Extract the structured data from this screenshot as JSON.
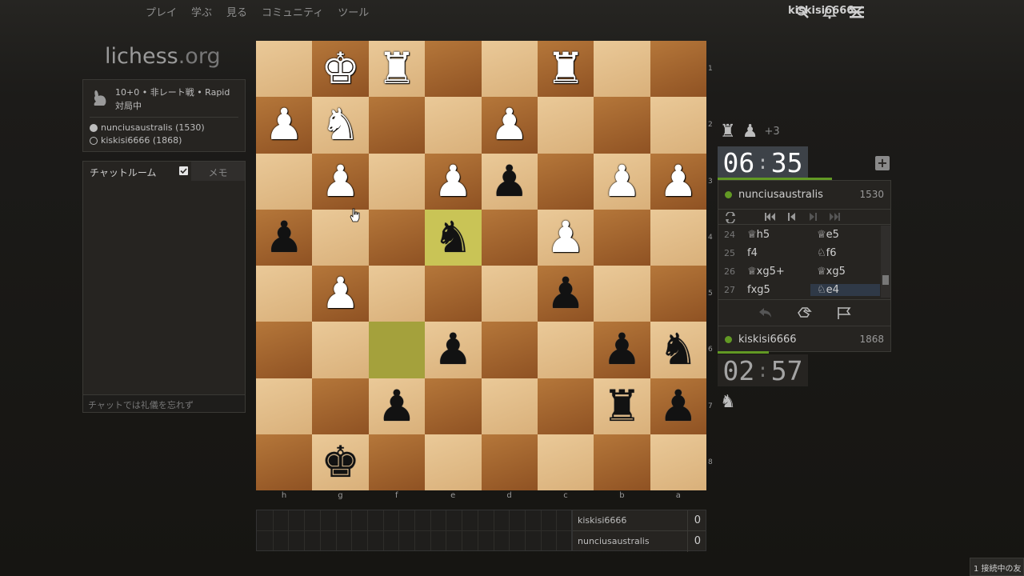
{
  "nav": {
    "items": [
      "プレイ",
      "学ぶ",
      "見る",
      "コミュニティ",
      "ツール"
    ],
    "username": "kiskisi6666"
  },
  "logo": {
    "main": "lichess",
    "suffix": ".org"
  },
  "game": {
    "setup": "10+0 • 非レート戦 • Rapid",
    "status": "対局中",
    "white_player": "nunciusaustralis (1530)",
    "black_player": "kiskisi6666 (1868)"
  },
  "chat": {
    "tab_chat": "チャットルーム",
    "tab_note": "メモ",
    "placeholder": "チャットでは礼儀を忘れず"
  },
  "board": {
    "ranks": [
      "1",
      "2",
      "3",
      "4",
      "5",
      "6",
      "7",
      "8"
    ],
    "files": [
      "h",
      "g",
      "f",
      "e",
      "d",
      "c",
      "b",
      "a"
    ],
    "rows": [
      [
        "",
        "wK",
        "wR",
        "",
        "",
        "wR",
        "",
        ""
      ],
      [
        "wP",
        "wN",
        "",
        "",
        "wP",
        "",
        "",
        ""
      ],
      [
        "",
        "wP",
        "",
        "wP",
        "bP",
        "",
        "wP",
        "wP"
      ],
      [
        "bP",
        "",
        "",
        "bN*",
        "",
        "wP",
        "",
        ""
      ],
      [
        "",
        "wP",
        "",
        "",
        "",
        "bP",
        "",
        ""
      ],
      [
        "",
        "",
        "*",
        "bP",
        "",
        "",
        "bP",
        "bN"
      ],
      [
        "",
        "",
        "bP",
        "",
        "",
        "",
        "bR",
        "bP"
      ],
      [
        "",
        "bK",
        "",
        "",
        "",
        "",
        "",
        ""
      ]
    ]
  },
  "opponent": {
    "name": "nunciusaustralis",
    "rating": "1530",
    "clock_min": "06",
    "clock_sec": "35",
    "captured": [
      "rook",
      "pawn"
    ],
    "material": "+3"
  },
  "player": {
    "name": "kiskisi6666",
    "rating": "1868",
    "clock_min": "02",
    "clock_sec": "57",
    "captured": [
      "knight"
    ]
  },
  "moves": [
    {
      "n": "24",
      "w": "♕h5",
      "b": "♕e5"
    },
    {
      "n": "25",
      "w": "f4",
      "b": "♘f6"
    },
    {
      "n": "26",
      "w": "♕xg5+",
      "b": "♕xg5"
    },
    {
      "n": "27",
      "w": "fxg5",
      "b": "♘e4"
    }
  ],
  "crosstable": [
    {
      "name": "kiskisi6666",
      "score": "0"
    },
    {
      "name": "nunciusaustralis",
      "score": "0"
    }
  ],
  "connection": "1 接続中の友",
  "colors": {
    "accent_green": "#629924",
    "highlight": "#c9c456"
  }
}
